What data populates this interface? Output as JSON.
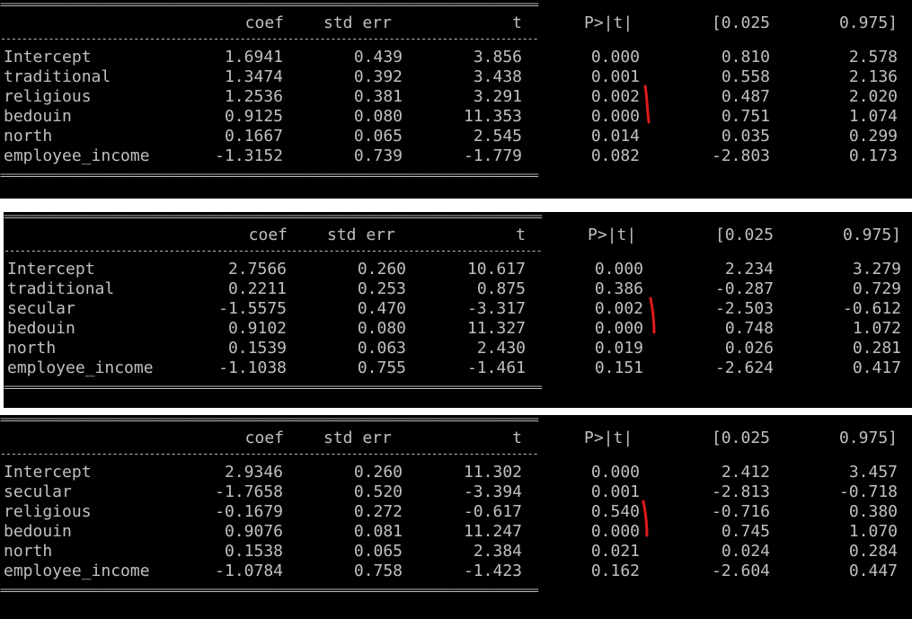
{
  "rule_line": "=====================================================================================================",
  "dash_line": "-----------------------------------------------------------------------------------------------------",
  "headers": {
    "coef": "coef",
    "std_err": "std err",
    "t": "t",
    "p": "P>|t|",
    "ci_low": "[0.025",
    "ci_high": "0.975]"
  },
  "tables": [
    {
      "rows": [
        {
          "label": "Intercept",
          "coef": "1.6941",
          "std_err": "0.439",
          "t": "3.856",
          "p": "0.000",
          "ci_low": "0.810",
          "ci_high": "2.578"
        },
        {
          "label": "traditional",
          "coef": "1.3474",
          "std_err": "0.392",
          "t": "3.438",
          "p": "0.001",
          "ci_low": "0.558",
          "ci_high": "2.136"
        },
        {
          "label": "religious",
          "coef": "1.2536",
          "std_err": "0.381",
          "t": "3.291",
          "p": "0.002",
          "ci_low": "0.487",
          "ci_high": "2.020"
        },
        {
          "label": "bedouin",
          "coef": "0.9125",
          "std_err": "0.080",
          "t": "11.353",
          "p": "0.000",
          "ci_low": "0.751",
          "ci_high": "1.074"
        },
        {
          "label": "north",
          "coef": "0.1667",
          "std_err": "0.065",
          "t": "2.545",
          "p": "0.014",
          "ci_low": "0.035",
          "ci_high": "0.299"
        },
        {
          "label": "employee_income",
          "coef": "-1.3152",
          "std_err": "0.739",
          "t": "-1.779",
          "p": "0.082",
          "ci_low": "-2.803",
          "ci_high": "0.173"
        }
      ]
    },
    {
      "rows": [
        {
          "label": "Intercept",
          "coef": "2.7566",
          "std_err": "0.260",
          "t": "10.617",
          "p": "0.000",
          "ci_low": "2.234",
          "ci_high": "3.279"
        },
        {
          "label": "traditional",
          "coef": "0.2211",
          "std_err": "0.253",
          "t": "0.875",
          "p": "0.386",
          "ci_low": "-0.287",
          "ci_high": "0.729"
        },
        {
          "label": "secular",
          "coef": "-1.5575",
          "std_err": "0.470",
          "t": "-3.317",
          "p": "0.002",
          "ci_low": "-2.503",
          "ci_high": "-0.612"
        },
        {
          "label": "bedouin",
          "coef": "0.9102",
          "std_err": "0.080",
          "t": "11.327",
          "p": "0.000",
          "ci_low": "0.748",
          "ci_high": "1.072"
        },
        {
          "label": "north",
          "coef": "0.1539",
          "std_err": "0.063",
          "t": "2.430",
          "p": "0.019",
          "ci_low": "0.026",
          "ci_high": "0.281"
        },
        {
          "label": "employee_income",
          "coef": "-1.1038",
          "std_err": "0.755",
          "t": "-1.461",
          "p": "0.151",
          "ci_low": "-2.624",
          "ci_high": "0.417"
        }
      ]
    },
    {
      "rows": [
        {
          "label": "Intercept",
          "coef": "2.9346",
          "std_err": "0.260",
          "t": "11.302",
          "p": "0.000",
          "ci_low": "2.412",
          "ci_high": "3.457"
        },
        {
          "label": "secular",
          "coef": "-1.7658",
          "std_err": "0.520",
          "t": "-3.394",
          "p": "0.001",
          "ci_low": "-2.813",
          "ci_high": "-0.718"
        },
        {
          "label": "religious",
          "coef": "-0.1679",
          "std_err": "0.272",
          "t": "-0.617",
          "p": "0.540",
          "ci_low": "-0.716",
          "ci_high": "0.380"
        },
        {
          "label": "bedouin",
          "coef": "0.9076",
          "std_err": "0.081",
          "t": "11.247",
          "p": "0.000",
          "ci_low": "0.745",
          "ci_high": "1.070"
        },
        {
          "label": "north",
          "coef": "0.1538",
          "std_err": "0.065",
          "t": "2.384",
          "p": "0.021",
          "ci_low": "0.024",
          "ci_high": "0.284"
        },
        {
          "label": "employee_income",
          "coef": "-1.0784",
          "std_err": "0.758",
          "t": "-1.423",
          "p": "0.162",
          "ci_low": "-2.604",
          "ci_high": "0.447"
        }
      ]
    }
  ],
  "colors": {
    "background": "#000000",
    "text": "#c0c0c0",
    "annotation": "#e01a1a"
  }
}
